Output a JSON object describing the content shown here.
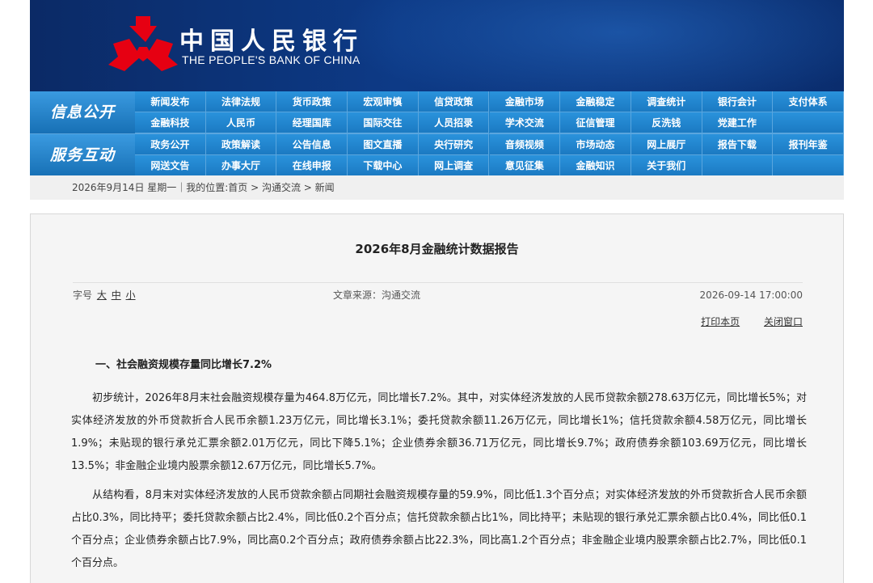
{
  "header": {
    "cn_name": "中国人民银行",
    "en_name": "THE PEOPLE'S BANK OF CHINA"
  },
  "nav": {
    "group1_title": "信息公开",
    "group2_title": "服务互动",
    "group1_items": [
      "新闻发布",
      "法律法规",
      "货币政策",
      "宏观审慎",
      "信贷政策",
      "金融市场",
      "金融稳定",
      "调查统计",
      "银行会计",
      "支付体系",
      "金融科技",
      "人民币",
      "经理国库",
      "国际交往",
      "人员招录",
      "学术交流",
      "征信管理",
      "反洗钱",
      "党建工作",
      ""
    ],
    "group2_items": [
      "政务公开",
      "政策解读",
      "公告信息",
      "图文直播",
      "央行研究",
      "音频视频",
      "市场动态",
      "网上展厅",
      "报告下载",
      "报刊年鉴",
      "网送文告",
      "办事大厅",
      "在线申报",
      "下载中心",
      "网上调查",
      "意见征集",
      "金融知识",
      "关于我们",
      "",
      ""
    ]
  },
  "breadcrumb": "2026年9月14日 星期一｜我的位置:首页 > 沟通交流 > 新闻",
  "article": {
    "title": "2026年8月金融统计数据报告",
    "font_size_label": "字号",
    "font_large": "大",
    "font_medium": "中",
    "font_small": "小",
    "source": "文章来源：沟通交流",
    "datetime": "2026-09-14 17:00:00",
    "print": "打印本页",
    "close": "关闭窗口",
    "heading1": "一、社会融资规模存量同比增长7.2%",
    "para1": "初步统计，2026年8月末社会融资规模存量为464.8万亿元，同比增长7.2%。其中，对实体经济发放的人民币贷款余额278.63万亿元，同比增长5%；对实体经济发放的外币贷款折合人民币余额1.23万亿元，同比增长3.1%；委托贷款余额11.26万亿元，同比增长1%；信托贷款余额4.58万亿元，同比增长1.9%；未贴现的银行承兑汇票余额2.01万亿元，同比下降5.1%；企业债券余额36.71万亿元，同比增长9.7%；政府债券余额103.69万亿元，同比增长13.5%；非金融企业境内股票余额12.67万亿元，同比增长5.7%。",
    "para2": "从结构看，8月末对实体经济发放的人民币贷款余额占同期社会融资规模存量的59.9%，同比低1.3个百分点；对实体经济发放的外币贷款折合人民币余额占比0.3%，同比持平；委托贷款余额占比2.4%，同比低0.2个百分点；信托贷款余额占比1%，同比持平；未贴现的银行承兑汇票余额占比0.4%，同比低0.1个百分点；企业债券余额占比7.9%，同比高0.2个百分点；政府债券余额占比22.3%，同比高1.2个百分点；非金融企业境内股票余额占比2.7%，同比低0.1个百分点。"
  },
  "colors": {
    "banner": "#0d3a86",
    "nav": "#1d7fc7",
    "logo_red": "#e60012"
  },
  "icons": {
    "logo": "pboc-emblem-icon"
  }
}
